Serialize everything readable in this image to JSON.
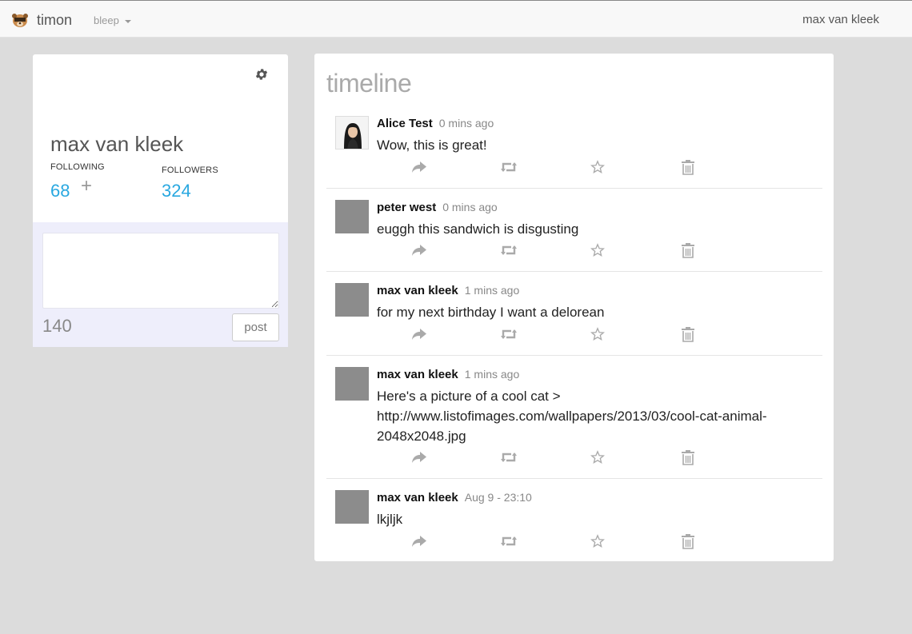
{
  "nav": {
    "brand": "timon",
    "app_menu": "bleep",
    "user": "max van kleek"
  },
  "profile": {
    "name": "max van kleek",
    "following_label": "FOLLOWING",
    "following_count": "68",
    "followers_label": "FOLLOWERS",
    "followers_count": "324",
    "add_icon": "+"
  },
  "compose": {
    "value": "",
    "char_count": "140",
    "post_label": "post"
  },
  "timeline": {
    "title": "timeline",
    "posts": [
      {
        "author": "Alice Test",
        "time": "0 mins ago",
        "text": "Wow, this is great!",
        "avatar": "photo"
      },
      {
        "author": "peter west",
        "time": "0 mins ago",
        "text": "euggh this sandwich is disgusting",
        "avatar": "placeholder"
      },
      {
        "author": "max van kleek",
        "time": "1 mins ago",
        "text": "for my next birthday I want a delorean",
        "avatar": "placeholder"
      },
      {
        "author": "max van kleek",
        "time": "1 mins ago",
        "text": "Here's a picture of a cool cat > http://www.listofimages.com/wallpapers/2013/03/cool-cat-animal-2048x2048.jpg",
        "avatar": "placeholder"
      },
      {
        "author": "max van kleek",
        "time": "Aug 9 - 23:10",
        "text": "lkjljk",
        "avatar": "placeholder"
      }
    ]
  },
  "icons": {
    "reply": "reply-arrow-icon",
    "repost": "retweet-icon",
    "favorite": "star-icon",
    "delete": "trash-icon",
    "settings": "gear-icon"
  },
  "colors": {
    "accent": "#29a8e0",
    "background": "#dcdcdc",
    "compose_bg": "#eeeefb",
    "icon": "#aaaaaa"
  }
}
